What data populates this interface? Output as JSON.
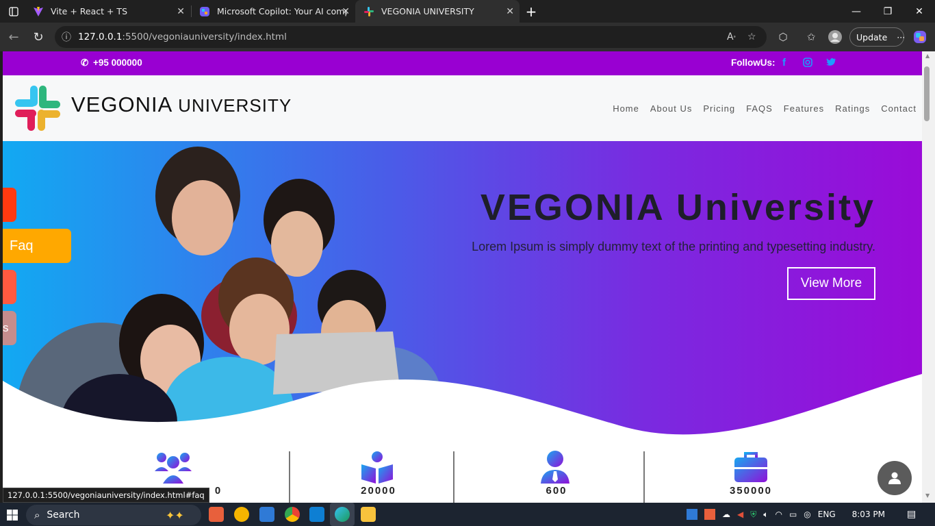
{
  "browser": {
    "tabs": [
      {
        "title": "Vite + React + TS"
      },
      {
        "title": "Microsoft Copilot: Your AI compa"
      },
      {
        "title": "VEGONIA UNIVERSITY"
      }
    ],
    "url_host": "127.0.0.1",
    "url_path": ":5500/vegoniauniversity/index.html",
    "update_label": "Update",
    "status_url": "127.0.0.1:5500/vegoniauniversity/index.html#faq"
  },
  "site": {
    "phone": "+95 000000",
    "follow_label": "FollowUs:",
    "brand_main": "VEGONIA",
    "brand_small": "UNIVERSITY",
    "nav": [
      "Home",
      "About Us",
      "Pricing",
      "FAQS",
      "Features",
      "Ratings",
      "Contact"
    ],
    "hero_title": "VEGONIA University",
    "hero_subtitle": "Lorem Ipsum is simply dummy text of the printing and typesetting industry.",
    "view_more": "View More",
    "side_faq": "Faq",
    "side_s": "s",
    "stats": [
      {
        "value": "0",
        "icon": "users-icon"
      },
      {
        "value": "20000",
        "icon": "book-reader-icon"
      },
      {
        "value": "600",
        "icon": "teacher-icon"
      },
      {
        "value": "350000",
        "icon": "briefcase-icon"
      }
    ],
    "colors": {
      "topbar": "#9900d2",
      "hero_start": "#12a9f2",
      "hero_end": "#9a0bd8",
      "accent_orange": "#ffa800",
      "accent_red": "#ff4a1c"
    }
  },
  "taskbar": {
    "search_label": "Search",
    "lang": "ENG",
    "time": "8:03 PM"
  }
}
